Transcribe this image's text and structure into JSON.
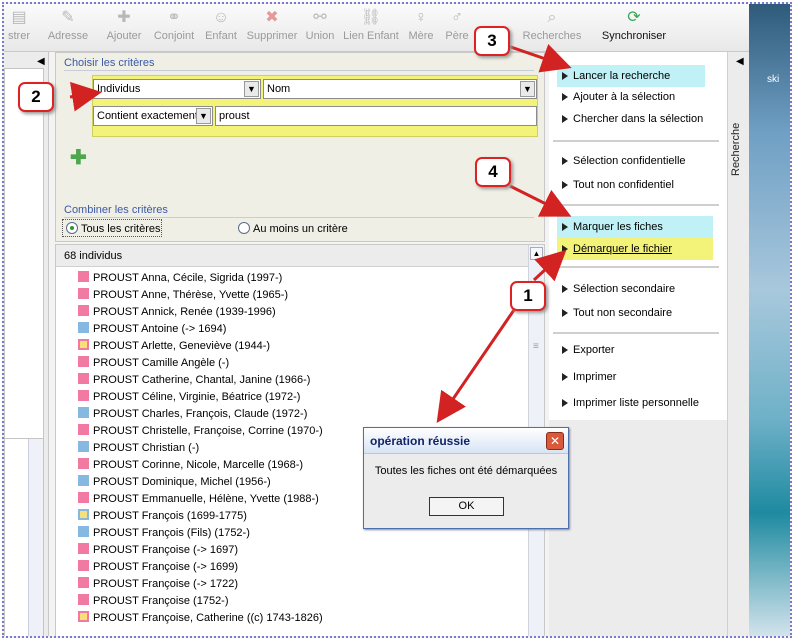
{
  "toolbar": {
    "items": [
      {
        "label": "strer",
        "icon": "register-icon"
      },
      {
        "label": "Adresse",
        "icon": "address-icon"
      },
      {
        "label": "Ajouter",
        "icon": "add-icon"
      },
      {
        "label": "Conjoint",
        "icon": "spouse-icon"
      },
      {
        "label": "Enfant",
        "icon": "child-icon"
      },
      {
        "label": "Supprimer",
        "icon": "delete-icon"
      },
      {
        "label": "Union",
        "icon": "union-icon"
      },
      {
        "label": "Lien Enfant",
        "icon": "child-link-icon"
      },
      {
        "label": "Mère",
        "icon": "mother-icon"
      },
      {
        "label": "Père",
        "icon": "father-icon"
      },
      {
        "label": "Recherches",
        "icon": "searches-icon"
      },
      {
        "label": "Synchroniser",
        "icon": "sync-icon"
      }
    ]
  },
  "criteria": {
    "title": "Choisir les critères",
    "field1": "Individus",
    "field2": "Nom",
    "operator": "Contient exactement",
    "value": "proust"
  },
  "combine": {
    "title": "Combiner les critères",
    "option_all": "Tous les critères",
    "option_any": "Au moins un critère",
    "selected": "all"
  },
  "list": {
    "count_label": "68  individus",
    "rows": [
      {
        "name": "PROUST Anna, Cécile, Sigrida (1997-)",
        "sex": "pink"
      },
      {
        "name": "PROUST Anne, Thérèse, Yvette (1965-)",
        "sex": "pink"
      },
      {
        "name": "PROUST Annick, Renée (1939-1996)",
        "sex": "pink"
      },
      {
        "name": "PROUST Antoine (-> 1694)",
        "sex": "blue"
      },
      {
        "name": "PROUST Arlette, Geneviève (1944-)",
        "sex": "mixed"
      },
      {
        "name": "PROUST Camille Angèle (-)",
        "sex": "pink"
      },
      {
        "name": "PROUST Catherine, Chantal, Janine (1966-)",
        "sex": "pink"
      },
      {
        "name": "PROUST Céline, Virginie, Béatrice (1972-)",
        "sex": "pink"
      },
      {
        "name": "PROUST Charles, François, Claude (1972-)",
        "sex": "blue"
      },
      {
        "name": "PROUST Christelle, Françoise, Corrine (1970-)",
        "sex": "pink"
      },
      {
        "name": "PROUST Christian (-)",
        "sex": "blue"
      },
      {
        "name": "PROUST Corinne, Nicole, Marcelle (1968-)",
        "sex": "pink"
      },
      {
        "name": "PROUST Dominique, Michel (1956-)",
        "sex": "blue"
      },
      {
        "name": "PROUST Emmanuelle, Hélène, Yvette (1988-)",
        "sex": "pink"
      },
      {
        "name": "PROUST François (1699-1775)",
        "sex": "mixed2"
      },
      {
        "name": "PROUST François (Fils) (1752-)",
        "sex": "blue"
      },
      {
        "name": "PROUST Françoise (-> 1697)",
        "sex": "pink"
      },
      {
        "name": "PROUST Françoise (-> 1699)",
        "sex": "pink"
      },
      {
        "name": "PROUST Françoise (-> 1722)",
        "sex": "pink"
      },
      {
        "name": "PROUST Françoise (1752-)",
        "sex": "pink"
      },
      {
        "name": "PROUST Françoise, Catherine ((c) 1743-1826)",
        "sex": "mixed"
      }
    ]
  },
  "actions": {
    "launch": "Lancer la recherche",
    "add_selection": "Ajouter à la sélection",
    "search_selection": "Chercher dans la sélection",
    "confidential_selection": "Sélection confidentielle",
    "all_non_confidential": "Tout non confidentiel",
    "mark": "Marquer les fiches",
    "unmark": "Démarquer le fichier",
    "secondary_selection": "Sélection secondaire",
    "all_non_secondary": "Tout non secondaire",
    "export": "Exporter",
    "print": "Imprimer",
    "print_personal": "Imprimer liste personnelle"
  },
  "side_tab": {
    "label": "Recherche"
  },
  "dialog": {
    "title": "opération réussie",
    "message": "Toutes les fiches ont été démarquées",
    "ok": "OK"
  },
  "callouts": {
    "one": "1",
    "two": "2",
    "three": "3",
    "four": "4"
  },
  "colors": {
    "highlight_yellow": "#f3f37a",
    "highlight_cyan": "#bff1f6",
    "callout_red": "#d22222"
  },
  "background": {
    "text": "ski"
  }
}
